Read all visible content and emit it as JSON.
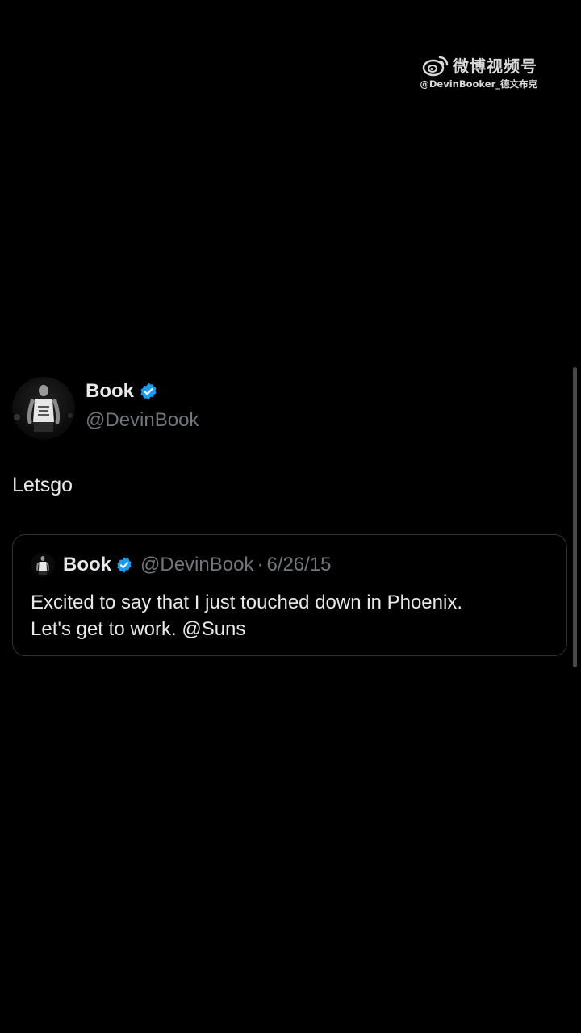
{
  "watermark": {
    "brand": "微博视频号",
    "handle": "@DevinBooker_德文布克",
    "logo_icon": "weibo-icon"
  },
  "tweet": {
    "author": {
      "display_name": "Book",
      "handle": "@DevinBook",
      "verified": true,
      "verified_color": "#1d9bf0"
    },
    "text": "Letsgo",
    "quoted": {
      "display_name": "Book",
      "handle": "@DevinBook",
      "separator": "·",
      "date": "6/26/15",
      "text_line1": "Excited to say that I just touched down in Phoenix.",
      "text_line2": "Let's get to work. @Suns"
    }
  },
  "colors": {
    "background": "#000000",
    "primary_text": "#e7e9ea",
    "secondary_text": "#71767b",
    "border": "#2f3336"
  }
}
